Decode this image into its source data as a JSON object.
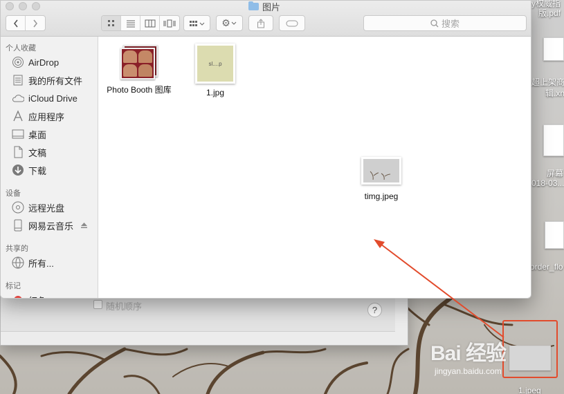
{
  "window": {
    "title": "图片",
    "search_placeholder": "搜索"
  },
  "toolbar": {
    "view_modes": [
      "icon-view",
      "list-view",
      "column-view",
      "cover-flow-view"
    ],
    "active_view": "icon-view"
  },
  "sidebar": {
    "favorites_header": "个人收藏",
    "favorites": [
      {
        "label": "AirDrop",
        "icon": "airdrop-icon"
      },
      {
        "label": "我的所有文件",
        "icon": "all-files-icon"
      },
      {
        "label": "iCloud Drive",
        "icon": "cloud-icon"
      },
      {
        "label": "应用程序",
        "icon": "applications-icon"
      },
      {
        "label": "桌面",
        "icon": "desktop-icon"
      },
      {
        "label": "文稿",
        "icon": "document-icon"
      },
      {
        "label": "下载",
        "icon": "download-icon"
      }
    ],
    "devices_header": "设备",
    "devices": [
      {
        "label": "远程光盘",
        "icon": "disc-icon"
      },
      {
        "label": "网易云音乐",
        "icon": "drive-icon"
      }
    ],
    "shared_header": "共享的",
    "shared": [
      {
        "label": "所有...",
        "icon": "network-icon"
      }
    ],
    "tags_header": "标记",
    "tags": [
      {
        "label": "红色",
        "color": "#e0443e"
      }
    ]
  },
  "files": [
    {
      "name": "Photo Booth 图库",
      "icon": "photo-booth-library-icon"
    },
    {
      "name": "1.jpg",
      "icon": "image-thumbnail-icon",
      "thumb_text": "sl....p"
    },
    {
      "name": "timg.jpeg",
      "icon": "image-thumbnail-icon"
    }
  ],
  "dialog": {
    "shuffle_label": "随机顺序",
    "help_label": "?"
  },
  "desktop": {
    "labels": [
      "y权威指",
      "版.pdf",
      "超上架商",
      "辑.xn",
      "屏幕",
      "018-03...",
      "order_flo",
      "1.jpeg"
    ]
  },
  "annotation": {
    "arrow_color": "#e24b2c",
    "watermark": "Bai 经验",
    "watermark_url": "jingyan.baidu.com"
  }
}
